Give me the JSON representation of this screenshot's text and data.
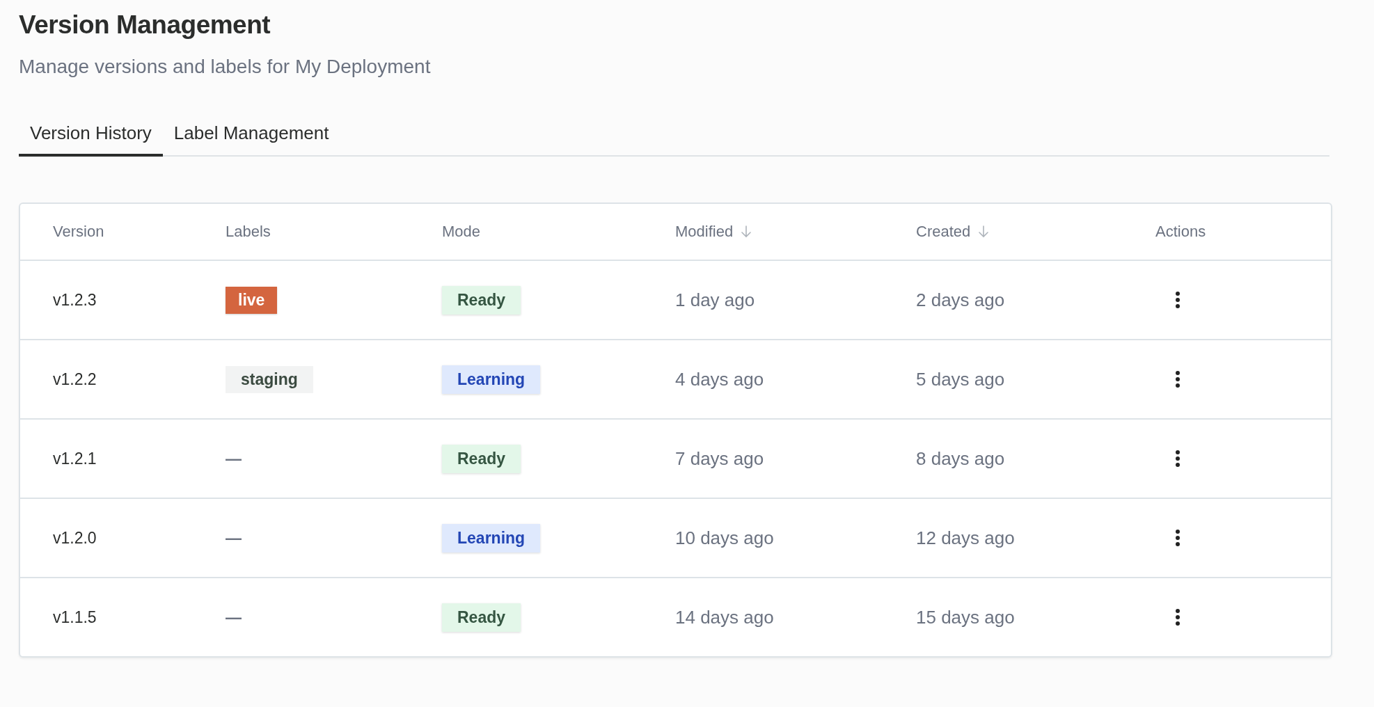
{
  "header": {
    "title": "Version Management",
    "subtitle": "Manage versions and labels for My Deployment"
  },
  "tabs": [
    {
      "label": "Version History",
      "selected": true
    },
    {
      "label": "Label Management",
      "selected": false
    }
  ],
  "table": {
    "columns": [
      {
        "label": "Version",
        "sortable": false
      },
      {
        "label": "Labels",
        "sortable": false
      },
      {
        "label": "Mode",
        "sortable": false
      },
      {
        "label": "Modified",
        "sortable": true
      },
      {
        "label": "Created",
        "sortable": true
      },
      {
        "label": "Actions",
        "sortable": false
      }
    ],
    "rows": [
      {
        "version": "v1.2.3",
        "label": {
          "kind": "live",
          "text": "live"
        },
        "mode": {
          "kind": "ready",
          "text": "Ready"
        },
        "modified": "1 day ago",
        "created": "2 days ago"
      },
      {
        "version": "v1.2.2",
        "label": {
          "kind": "staging",
          "text": "staging"
        },
        "mode": {
          "kind": "learning",
          "text": "Learning"
        },
        "modified": "4 days ago",
        "created": "5 days ago"
      },
      {
        "version": "v1.2.1",
        "label": {
          "kind": "none",
          "text": "—"
        },
        "mode": {
          "kind": "ready",
          "text": "Ready"
        },
        "modified": "7 days ago",
        "created": "8 days ago"
      },
      {
        "version": "v1.2.0",
        "label": {
          "kind": "none",
          "text": "—"
        },
        "mode": {
          "kind": "learning",
          "text": "Learning"
        },
        "modified": "10 days ago",
        "created": "12 days ago"
      },
      {
        "version": "v1.1.5",
        "label": {
          "kind": "none",
          "text": "—"
        },
        "mode": {
          "kind": "ready",
          "text": "Ready"
        },
        "modified": "14 days ago",
        "created": "15 days ago"
      }
    ]
  }
}
